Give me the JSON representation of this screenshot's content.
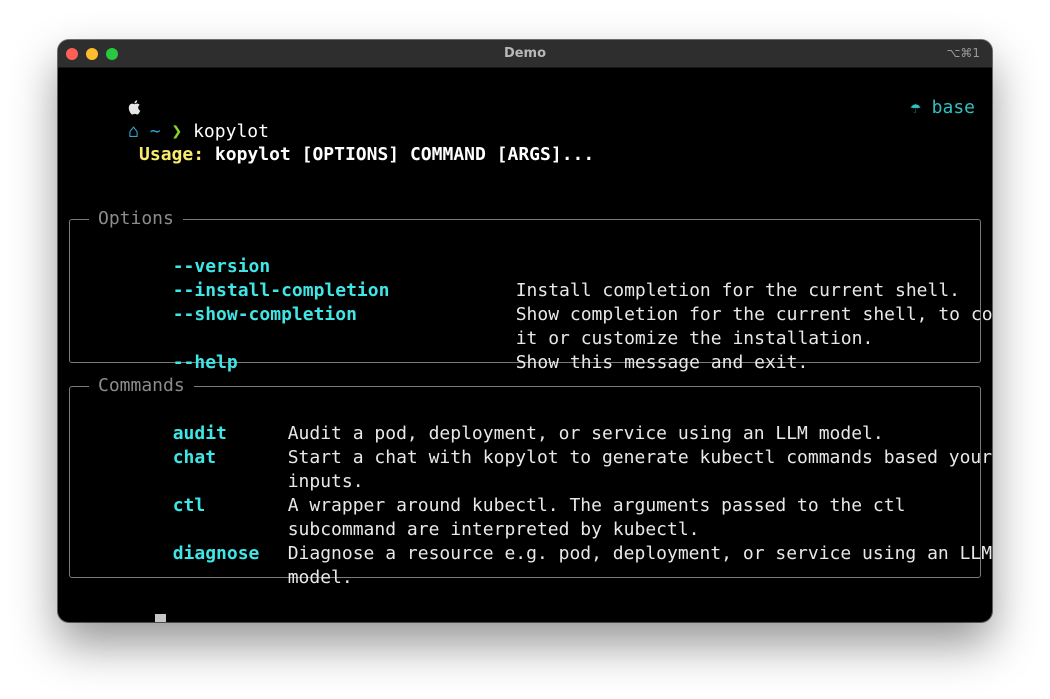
{
  "window": {
    "title": "Demo",
    "shortcut": "⌥⌘1"
  },
  "prompt": {
    "apple_icon": "apple-icon",
    "home_icon": "home-icon",
    "home_glyph": "⌂",
    "tilde": "~",
    "chevron": "❯",
    "command": "kopylot",
    "env_icon": "python-icon",
    "env_glyph": "☂",
    "env_name": "base"
  },
  "usage": {
    "label": "Usage:",
    "text": "kopylot [OPTIONS] COMMAND [ARGS]..."
  },
  "options": {
    "title": "Options",
    "items": [
      {
        "flag": "--version",
        "desc": []
      },
      {
        "flag": "--install-completion",
        "desc": [
          "Install completion for the current shell."
        ]
      },
      {
        "flag": "--show-completion",
        "desc": [
          "Show completion for the current shell, to copy",
          "it or customize the installation."
        ]
      },
      {
        "flag": "--help",
        "desc": [
          "Show this message and exit."
        ]
      }
    ]
  },
  "commands": {
    "title": "Commands",
    "items": [
      {
        "name": "audit",
        "desc": [
          "Audit a pod, deployment, or service using an LLM model."
        ]
      },
      {
        "name": "chat",
        "desc": [
          "Start a chat with kopylot to generate kubectl commands based your",
          "inputs."
        ]
      },
      {
        "name": "ctl",
        "desc": [
          "A wrapper around kubectl. The arguments passed to the ctl",
          "subcommand are interpreted by kubectl."
        ]
      },
      {
        "name": "diagnose",
        "desc": [
          "Diagnose a resource e.g. pod, deployment, or service using an LLM",
          "model."
        ]
      }
    ]
  },
  "colors": {
    "usage_label": "#f7ec6d",
    "option_flag": "#40e5e5",
    "prompt_path": "#2fa4cf",
    "prompt_chevron": "#8ad62c",
    "env": "#2fc1c1"
  }
}
